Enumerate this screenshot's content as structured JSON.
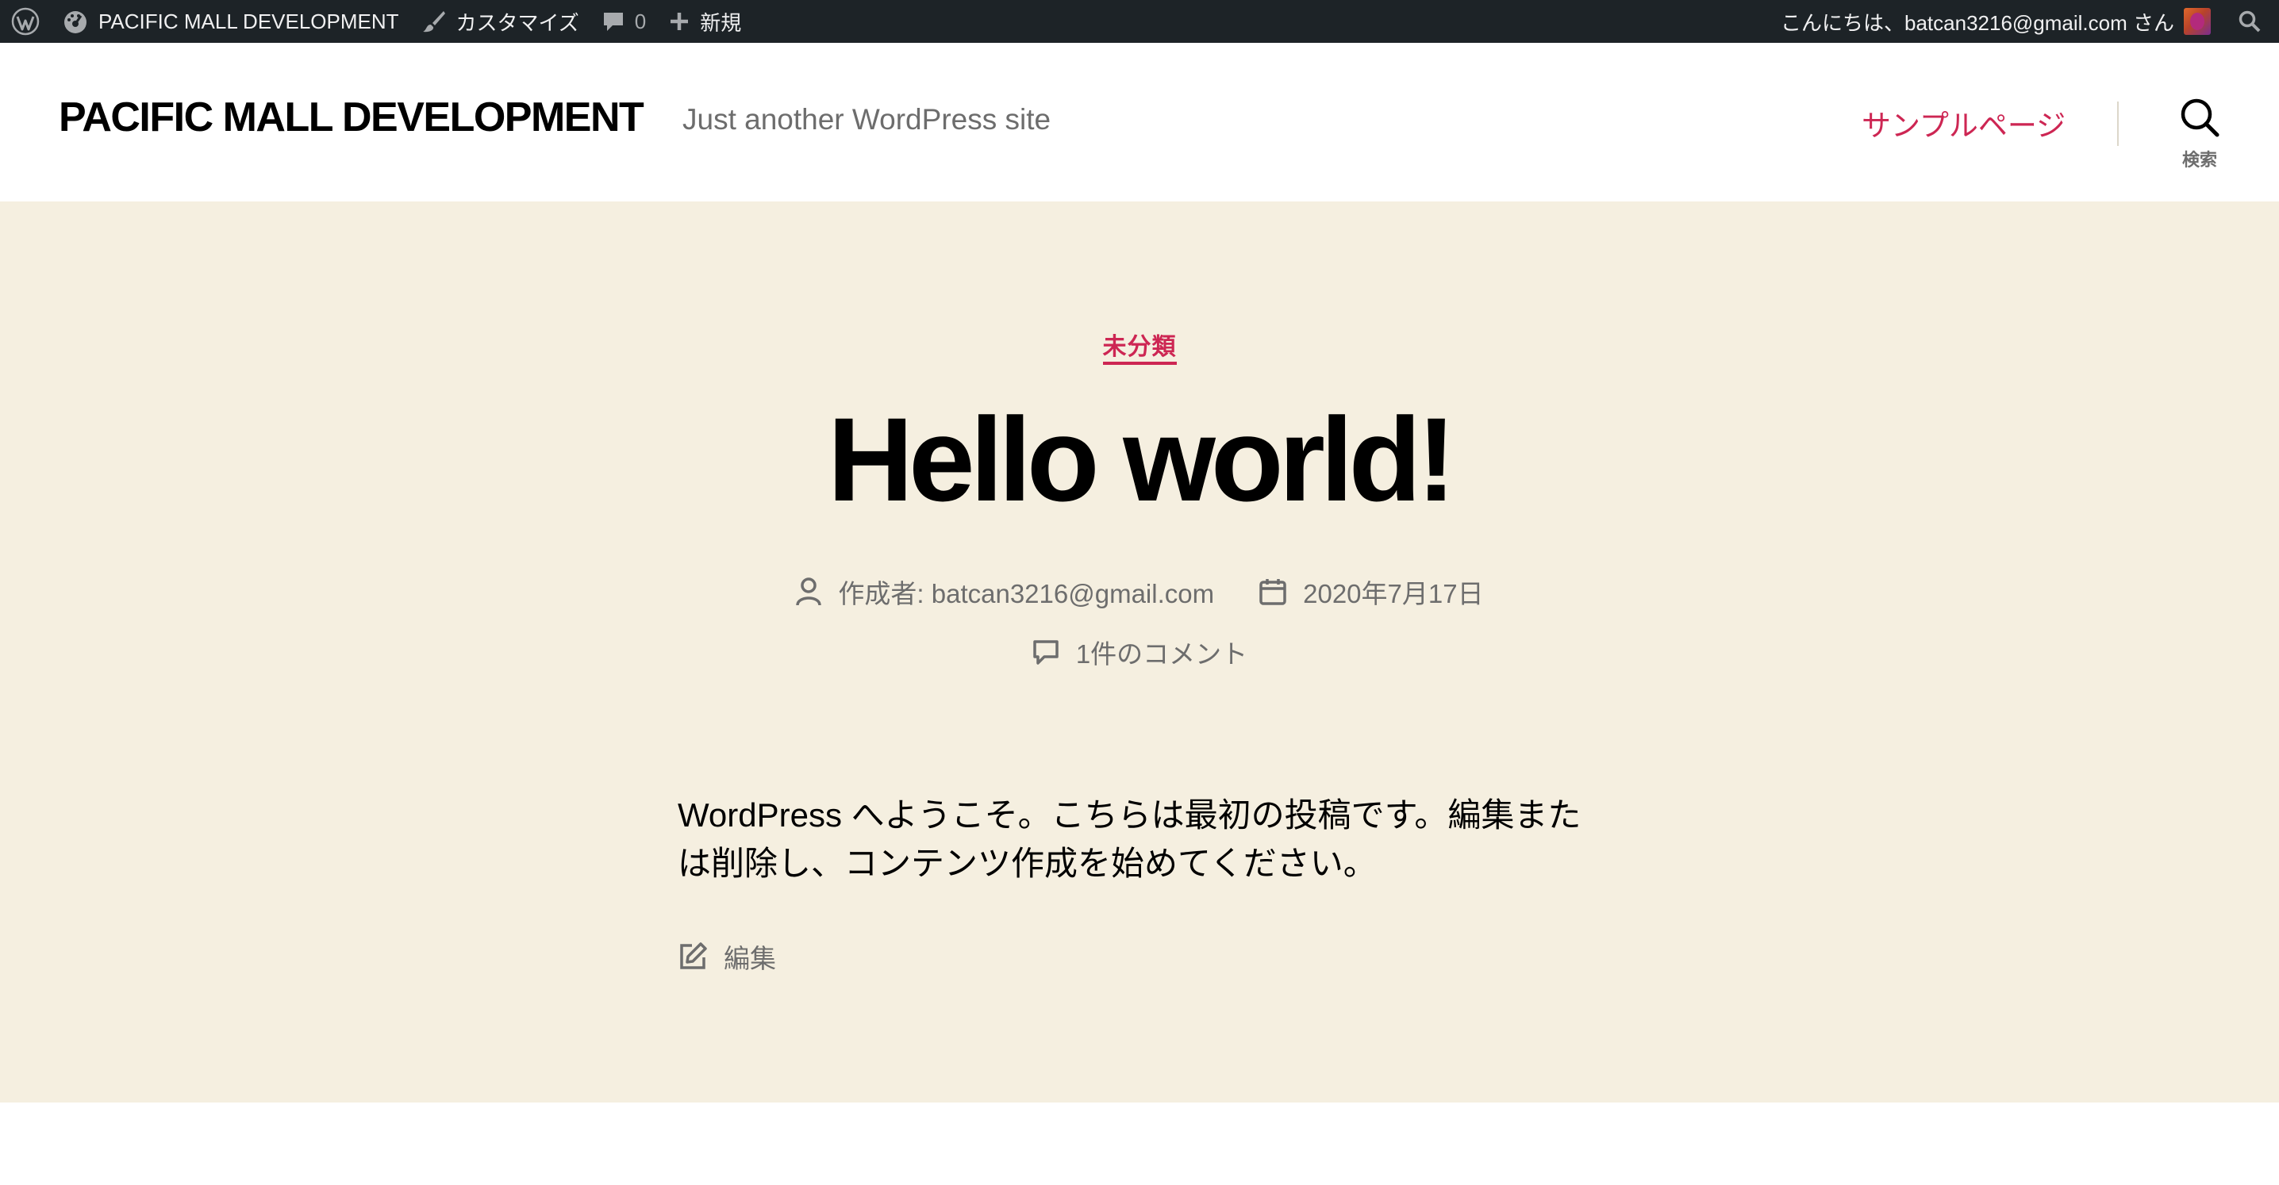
{
  "adminbar": {
    "site_name": "PACIFIC MALL DEVELOPMENT",
    "customize": "カスタマイズ",
    "comments_count": "0",
    "new": "新規",
    "greeting": "こんにちは、batcan3216@gmail.com さん"
  },
  "header": {
    "site_title": "PACIFIC MALL DEVELOPMENT",
    "site_description": "Just another WordPress site",
    "nav_link": "サンプルページ",
    "search_label": "検索"
  },
  "post": {
    "category": "未分類",
    "title": "Hello world!",
    "author": "作成者: batcan3216@gmail.com",
    "date": "2020年7月17日",
    "comments": "1件のコメント",
    "content": "WordPress へようこそ。こちらは最初の投稿です。編集または削除し、コンテンツ作成を始めてください。",
    "edit": "編集"
  },
  "colors": {
    "adminbar_bg": "#1d2327",
    "accent": "#cd2653",
    "band_bg": "#f5efe0",
    "meta_text": "#6d6d6d"
  }
}
